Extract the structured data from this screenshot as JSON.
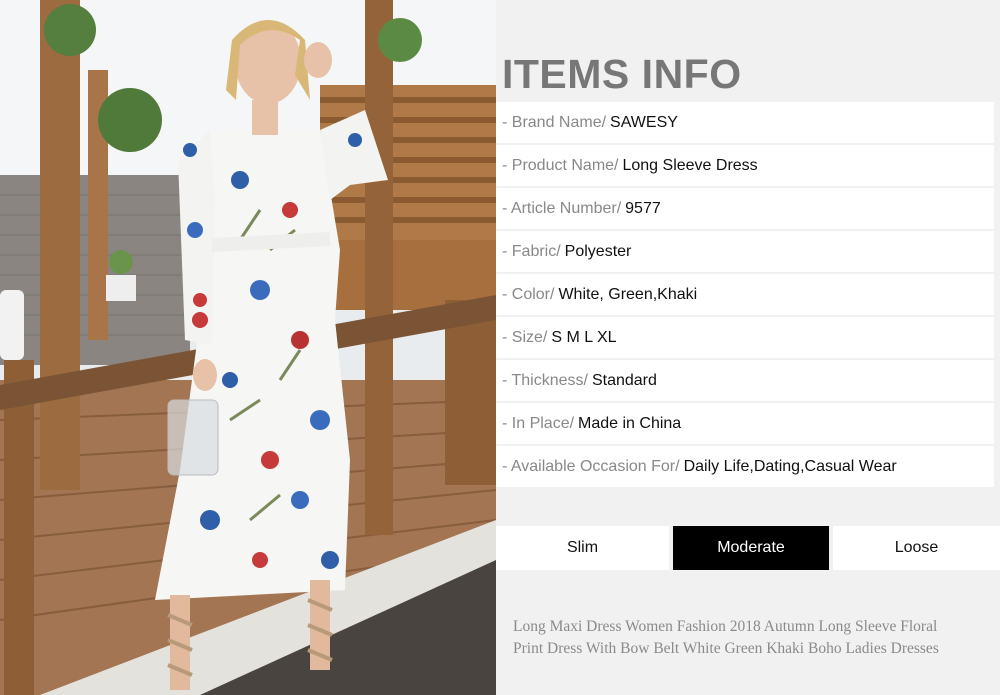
{
  "title": "ITEMS INFO",
  "specs": [
    {
      "label": "- Brand Name/",
      "value": "SAWESY"
    },
    {
      "label": "- Product Name/",
      "value": "Long Sleeve Dress"
    },
    {
      "label": "- Article Number/",
      "value": "9577"
    },
    {
      "label": "- Fabric/",
      "value": "Polyester"
    },
    {
      "label": "- Color/",
      "value": "White, Green,Khaki"
    },
    {
      "label": "- Size/",
      "value": "S M L XL"
    },
    {
      "label": "- Thickness/",
      "value": "Standard"
    },
    {
      "label": "- In Place/",
      "value": "Made in China"
    },
    {
      "label": "- Available Occasion For/",
      "value": "Daily Life,Dating,Casual Wear"
    }
  ],
  "fit": {
    "options": [
      "Slim",
      "Moderate",
      "Loose"
    ],
    "selected": "Moderate"
  },
  "description_lines": [
    "Long Maxi Dress Women  Fashion 2018 Autumn Long Sleeve Floral",
    "Print Dress With Bow Belt White Green Khaki Boho Ladies Dresses"
  ],
  "colors": {
    "panel_bg": "#f1f1f1",
    "title": "#777777",
    "label": "#888888",
    "selected_fit_bg": "#000000"
  }
}
